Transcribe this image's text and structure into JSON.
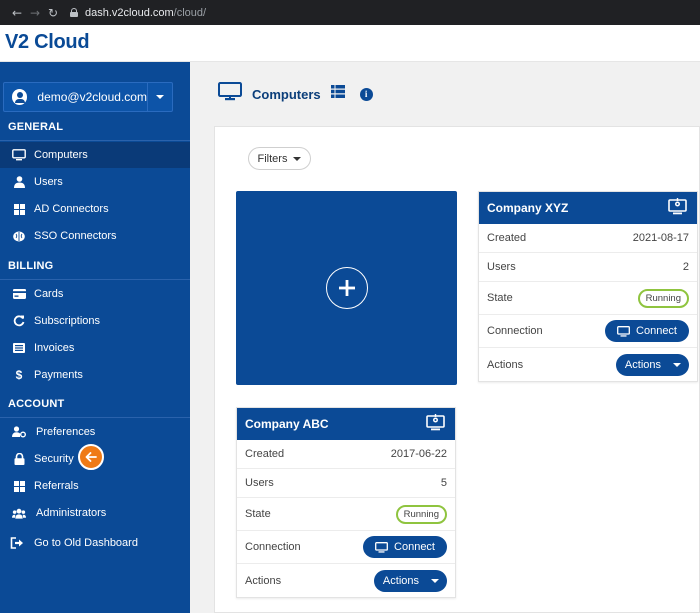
{
  "browser": {
    "url_host": "dash.v2cloud.com",
    "url_path": "/cloud/"
  },
  "header": {
    "logo": "V2 Cloud"
  },
  "sidebar": {
    "user_email": "demo@v2cloud.com",
    "sections": {
      "general": "GENERAL",
      "billing": "BILLING",
      "account": "ACCOUNT"
    },
    "items": [
      {
        "label": "Computers",
        "icon": "monitor-icon"
      },
      {
        "label": "Users",
        "icon": "user-icon"
      },
      {
        "label": "AD Connectors",
        "icon": "windows-icon"
      },
      {
        "label": "SSO Connectors",
        "icon": "brain-icon"
      },
      {
        "label": "Cards",
        "icon": "credit-card-icon"
      },
      {
        "label": "Subscriptions",
        "icon": "refresh-icon"
      },
      {
        "label": "Invoices",
        "icon": "list-icon"
      },
      {
        "label": "Payments",
        "icon": "dollar-icon"
      },
      {
        "label": "Preferences",
        "icon": "user-cog-icon"
      },
      {
        "label": "Security",
        "icon": "lock-icon"
      },
      {
        "label": "Referrals",
        "icon": "windows-icon"
      },
      {
        "label": "Administrators",
        "icon": "users-icon"
      },
      {
        "label": "Go to Old Dashboard",
        "icon": "exit-icon"
      }
    ],
    "active_item": "Computers",
    "accent_color": "#ef7a16"
  },
  "main": {
    "title": "Computers",
    "filters_label": "Filters",
    "cards": [
      {
        "name": "Company XYZ",
        "created_label": "Created",
        "created": "2021-08-17",
        "users_label": "Users",
        "users": "2",
        "state_label": "State",
        "state": "Running",
        "connection_label": "Connection",
        "connect_button": "Connect",
        "actions_label": "Actions",
        "actions_button": "Actions"
      },
      {
        "name": "Company ABC",
        "created_label": "Created",
        "created": "2017-06-22",
        "users_label": "Users",
        "users": "5",
        "state_label": "State",
        "state": "Running",
        "connection_label": "Connection",
        "connect_button": "Connect",
        "actions_label": "Actions",
        "actions_button": "Actions"
      }
    ]
  },
  "colors": {
    "brand_blue": "#0b4a96",
    "running_green": "#8fc43f"
  }
}
